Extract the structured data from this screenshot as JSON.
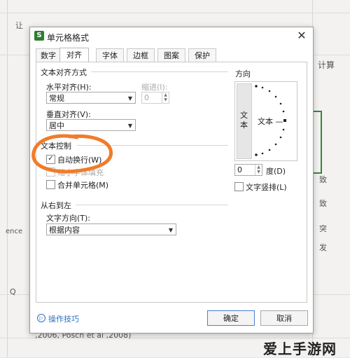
{
  "background": {
    "top_left_fragment": "让",
    "top_right_fragment": "计算",
    "left_fragment_1": "ence",
    "left_fragment_2": "Q",
    "right_fragment_1": "致",
    "right_fragment_2": "致",
    "right_fragment_3": "突",
    "right_fragment_4": "发",
    "bottom_fragment": ",2006, Posch et al ,2008)"
  },
  "dialog": {
    "title": "单元格格式",
    "app_icon_letter": "S",
    "tabs": [
      "数字",
      "对齐",
      "字体",
      "边框",
      "图案",
      "保护"
    ],
    "active_tab": "对齐",
    "text_align": {
      "header": "文本对齐方式",
      "horizontal_label": "水平对齐(H):",
      "horizontal_value": "常规",
      "indent_label": "缩进(I):",
      "indent_value": "0",
      "vertical_label": "垂直对齐(V):",
      "vertical_value": "居中"
    },
    "text_control": {
      "header": "文本控制",
      "wrap_label": "自动换行(W)",
      "wrap_checked": "✓",
      "shrink_label": "缩小字体填充",
      "merge_label": "合并单元格(M)"
    },
    "rtl": {
      "header": "从右到左",
      "direction_label": "文字方向(T):",
      "direction_value": "根据内容"
    },
    "orientation": {
      "header": "方向",
      "vertical_text": "文本",
      "horizontal_text": "文本 —",
      "degree_value": "0",
      "degree_label": "度(D)",
      "stack_label": "文字竖排(L)"
    },
    "tips_label": "操作技巧",
    "ok_label": "确定",
    "cancel_label": "取消"
  },
  "watermark": "爱上手游网",
  "colors": {
    "annotation": "#f07c2a",
    "accent": "#4a7fd6",
    "link": "#2f6fc2"
  }
}
